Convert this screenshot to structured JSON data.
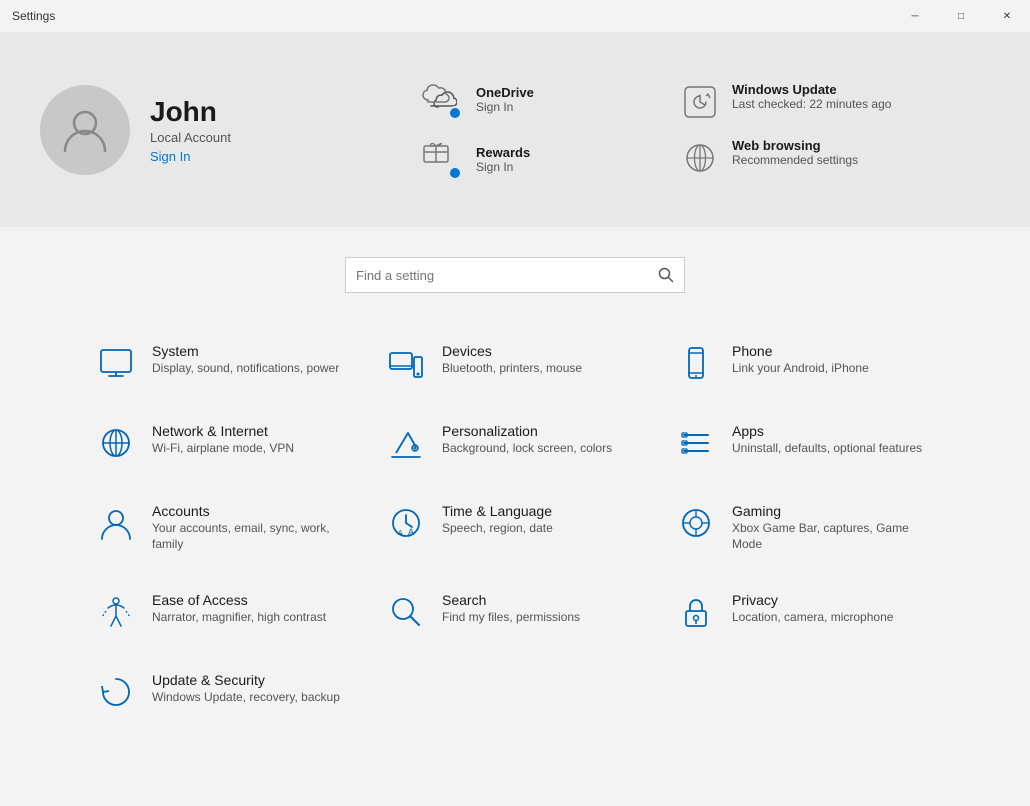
{
  "titlebar": {
    "title": "Settings",
    "minimize_label": "─",
    "restore_label": "□",
    "close_label": "✕"
  },
  "profile": {
    "name": "John",
    "account_type": "Local Account",
    "signin_label": "Sign In"
  },
  "services": [
    {
      "id": "onedrive",
      "name": "OneDrive",
      "sub": "Sign In",
      "has_dot": true
    },
    {
      "id": "rewards",
      "name": "Rewards",
      "sub": "Sign In",
      "has_dot": true
    }
  ],
  "right_services": [
    {
      "id": "windows-update",
      "name": "Windows Update",
      "sub": "Last checked: 22 minutes ago"
    },
    {
      "id": "web-browsing",
      "name": "Web browsing",
      "sub": "Recommended settings"
    }
  ],
  "search": {
    "placeholder": "Find a setting"
  },
  "settings": [
    {
      "id": "system",
      "name": "System",
      "desc": "Display, sound, notifications, power"
    },
    {
      "id": "devices",
      "name": "Devices",
      "desc": "Bluetooth, printers, mouse"
    },
    {
      "id": "phone",
      "name": "Phone",
      "desc": "Link your Android, iPhone"
    },
    {
      "id": "network",
      "name": "Network & Internet",
      "desc": "Wi-Fi, airplane mode, VPN"
    },
    {
      "id": "personalization",
      "name": "Personalization",
      "desc": "Background, lock screen, colors"
    },
    {
      "id": "apps",
      "name": "Apps",
      "desc": "Uninstall, defaults, optional features"
    },
    {
      "id": "accounts",
      "name": "Accounts",
      "desc": "Your accounts, email, sync, work, family"
    },
    {
      "id": "time-language",
      "name": "Time & Language",
      "desc": "Speech, region, date"
    },
    {
      "id": "gaming",
      "name": "Gaming",
      "desc": "Xbox Game Bar, captures, Game Mode"
    },
    {
      "id": "ease-of-access",
      "name": "Ease of Access",
      "desc": "Narrator, magnifier, high contrast"
    },
    {
      "id": "search",
      "name": "Search",
      "desc": "Find my files, permissions"
    },
    {
      "id": "privacy",
      "name": "Privacy",
      "desc": "Location, camera, microphone"
    },
    {
      "id": "update-security",
      "name": "Update & Security",
      "desc": "Windows Update, recovery, backup"
    }
  ]
}
